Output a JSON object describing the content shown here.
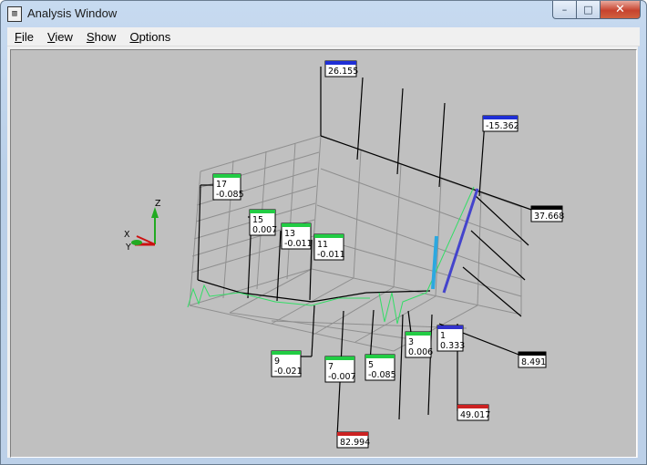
{
  "window": {
    "title": "Analysis Window",
    "app_icon_glyph": "▥",
    "buttons": {
      "minimize": "–",
      "maximize": "□",
      "close": "✕"
    }
  },
  "menu": [
    {
      "access_key": "F",
      "rest": "ile"
    },
    {
      "access_key": "V",
      "rest": "iew"
    },
    {
      "access_key": "S",
      "rest": "how"
    },
    {
      "access_key": "O",
      "rest": "ptions"
    }
  ],
  "axes_indicator": {
    "x": "X",
    "y": "Y",
    "z": "Z"
  },
  "node_labels": [
    {
      "id": "17",
      "value": "-0.085",
      "color": "#22cc44"
    },
    {
      "id": "15",
      "value": "0.007",
      "color": "#22cc44"
    },
    {
      "id": "13",
      "value": "-0.011",
      "color": "#22cc44"
    },
    {
      "id": "11",
      "value": "-0.011",
      "color": "#22cc44"
    },
    {
      "id": "9",
      "value": "-0.021",
      "color": "#22cc44"
    },
    {
      "id": "7",
      "value": "-0.007",
      "color": "#22cc44"
    },
    {
      "id": "5",
      "value": "-0.085",
      "color": "#22cc44"
    },
    {
      "id": "3",
      "value": "0.006",
      "color": "#22cc44"
    },
    {
      "id": "1",
      "value": "0.333",
      "color": "#3333cc"
    }
  ],
  "value_labels": [
    {
      "value": "26.155",
      "color": "#1f2fd6"
    },
    {
      "value": "-15.362",
      "color": "#1f2fd6"
    },
    {
      "value": "37.668",
      "color": "#000000"
    },
    {
      "value": "8.491",
      "color": "#000000"
    },
    {
      "value": "49.017",
      "color": "#cc2222"
    },
    {
      "value": "82.994",
      "color": "#cc2222"
    }
  ]
}
